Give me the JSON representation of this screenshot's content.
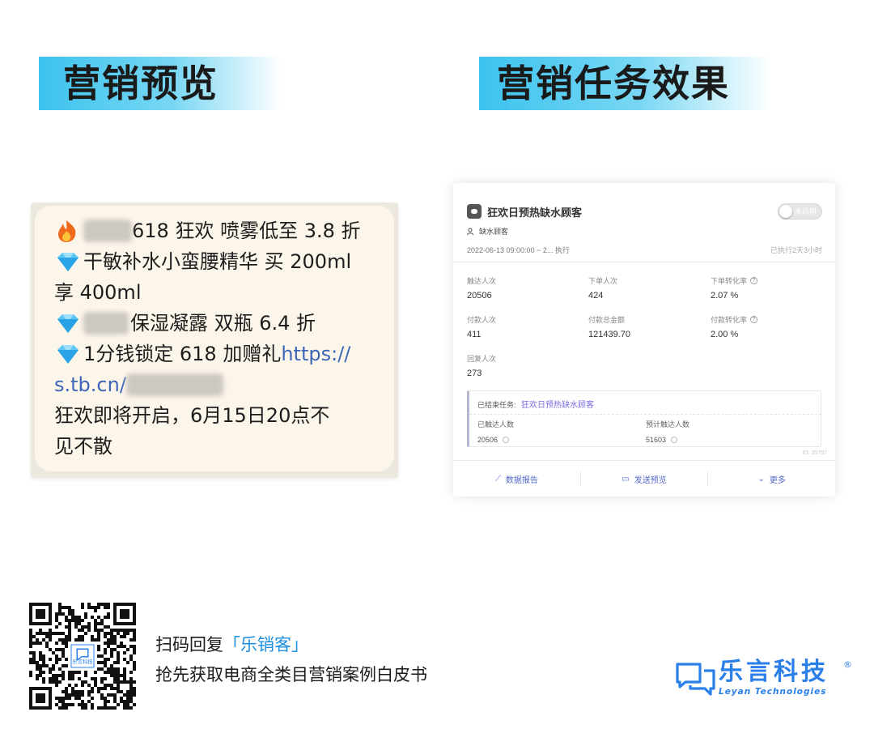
{
  "left_section": {
    "title": "营销预览"
  },
  "right_section": {
    "title": "营销任务效果"
  },
  "sms": {
    "line1": "618 狂欢 喷雾低至 3.8 折",
    "line2": "干敏补水小蛮腰精华 买 200ml",
    "line3": "享 400ml",
    "line4": "保湿凝露 双瓶 6.4 折",
    "line5_text": "1分钱锁定 618 加赠礼 ",
    "line5_link": "https://",
    "line6_link": "s.tb.cn/",
    "line7": "狂欢即将开启，6月15日20点不",
    "line8": "见不散",
    "icons": [
      "fire-emoji",
      "diamond-emoji"
    ]
  },
  "task": {
    "title": "狂欢日预热缺水顾客",
    "toggle_label": "未启用",
    "audience": "缺水顾客",
    "date_range": "2022-06-13 09:00:00 ~ 2...  执行",
    "executed": "已执行2天3小时",
    "metrics": [
      {
        "label": "触达人次",
        "value": "20506"
      },
      {
        "label": "下单人次",
        "value": "424"
      },
      {
        "label": "下单转化率",
        "value": "2.07  %"
      },
      {
        "label": "付款人次",
        "value": "411"
      },
      {
        "label": "付款总金额",
        "value": "121439.70"
      },
      {
        "label": "付款转化率",
        "value": "2.00  %"
      },
      {
        "label": "回复人次",
        "value": "273"
      }
    ],
    "ended": {
      "label": "已结束任务:",
      "link": "狂欢日预热缺水顾客",
      "reached_label": "已触达人数",
      "reached_value": "20506",
      "expected_label": "预计触达人数",
      "expected_value": "51603"
    },
    "id_text": "ID: 35797",
    "footer": {
      "report": "数据报告",
      "preview": "发送预览",
      "more": "更多"
    }
  },
  "promo": {
    "line1_prefix": "扫码回复",
    "line1_accent": "「乐销客」",
    "line2": "抢先获取电商全类目营销案例白皮书"
  },
  "qr": {
    "center_label": "乐言科技"
  },
  "logo": {
    "name": "乐言科技",
    "reg": "®",
    "english": "Leyan  Technologies"
  },
  "colors": {
    "banner": "#3cc3ee",
    "link": "#3c66b8",
    "brand": "#2a7fe8",
    "accent": "#1e8fe0"
  }
}
